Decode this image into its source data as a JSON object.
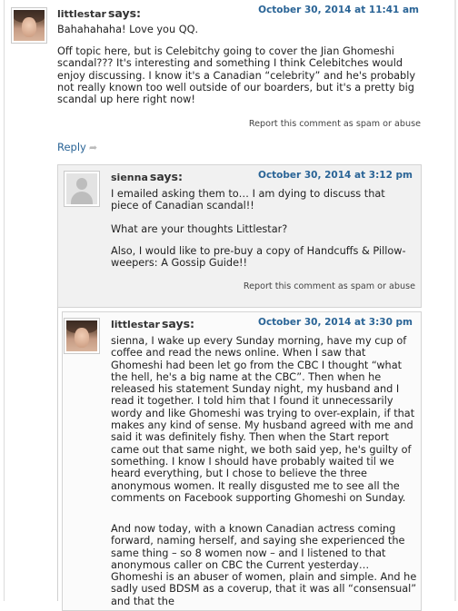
{
  "comments": [
    {
      "author": "littlestar",
      "says": "says:",
      "date": "October 30, 2014 at 11:41 am",
      "avatar": "photo-avatar",
      "paragraphs": [
        "Bahahahaha! Love you QQ.",
        "Off topic here, but is Celebitchy going to cover the Jian Ghomeshi scandal??? It's interesting and something I think Celebitches would enjoy discussing. I know it's a Canadian “celebrity” and he's probably not really known too well outside of our boarders, but it's a pretty big scandal up here right now!"
      ],
      "report": "Report this comment as spam or abuse",
      "reply": "Reply"
    },
    {
      "author": "sienna",
      "says": "says:",
      "date": "October 30, 2014 at 3:12 pm",
      "avatar": "default-avatar",
      "paragraphs": [
        "I emailed asking them to… I am dying to discuss that piece of Canadian scandal!!",
        "What are your thoughts Littlestar?",
        "Also, I would like to pre-buy a copy of Handcuffs & Pillow-weepers: A Gossip Guide!!"
      ],
      "report": "Report this comment as spam or abuse"
    },
    {
      "author": "littlestar",
      "says": "says:",
      "date": "October 30, 2014 at 3:30 pm",
      "avatar": "photo-avatar",
      "paragraphs": [
        "sienna, I wake up every Sunday morning, have my cup of coffee and read the news online. When I saw that Ghomeshi had been let go from the CBC I thought “what the hell, he's a big name at the CBC”. Then when he released his statement Sunday night, my husband and I read it together. I told him that I found it unnecessarily wordy and like Ghomeshi was trying to over-explain, if that makes any kind of sense. My husband agreed with me and said it was definitely fishy. Then when the Start report came out that same night, we both said yep, he's guilty of something. I know I should have probably waited til we heard everything, but I chose to believe the three anonymous women. It really disgusted me to see all the comments on Facebook supporting Ghomeshi on Sunday.",
        "And now today, with a known Canadian actress coming forward, naming herself, and saying she experienced the same thing – so 8 women now – and I listened to that anonymous caller on CBC the Current yesterday… Ghomeshi is an abuser of women, plain and simple. And he sadly used BDSM as a coverup, that it was all “consensual” and that the"
      ]
    }
  ]
}
